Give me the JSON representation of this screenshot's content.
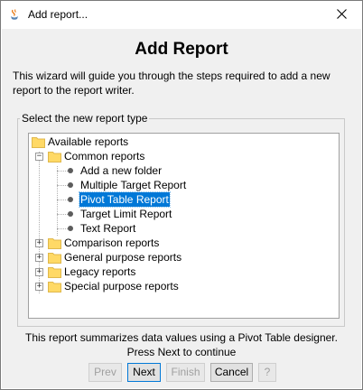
{
  "window": {
    "title": "Add report...",
    "app_icon": "java-coffee-icon",
    "close_icon": "close-icon"
  },
  "wizard": {
    "heading": "Add Report",
    "description": "This wizard will guide you through the steps required to add a new report to the report writer."
  },
  "selector": {
    "group_label": "Select the new report type",
    "tree": {
      "root": "Available reports",
      "common": {
        "label": "Common reports",
        "items": [
          "Add a new folder",
          "Multiple Target Report",
          "Pivot Table Report",
          "Target Limit Report",
          "Text Report"
        ],
        "selected": "Pivot Table Report"
      },
      "collapsed_folders": [
        "Comparison reports",
        "General purpose reports",
        "Legacy reports",
        "Special purpose reports"
      ]
    }
  },
  "info": {
    "line1": "This report summarizes data values using a Pivot Table designer.",
    "line2": "Press Next to continue"
  },
  "buttons": {
    "prev": "Prev",
    "next": "Next",
    "finish": "Finish",
    "cancel": "Cancel",
    "help": "?"
  },
  "colors": {
    "selection": "#0078d7",
    "folder": "#ffd966",
    "dialog_bg": "#f0f0f0"
  }
}
